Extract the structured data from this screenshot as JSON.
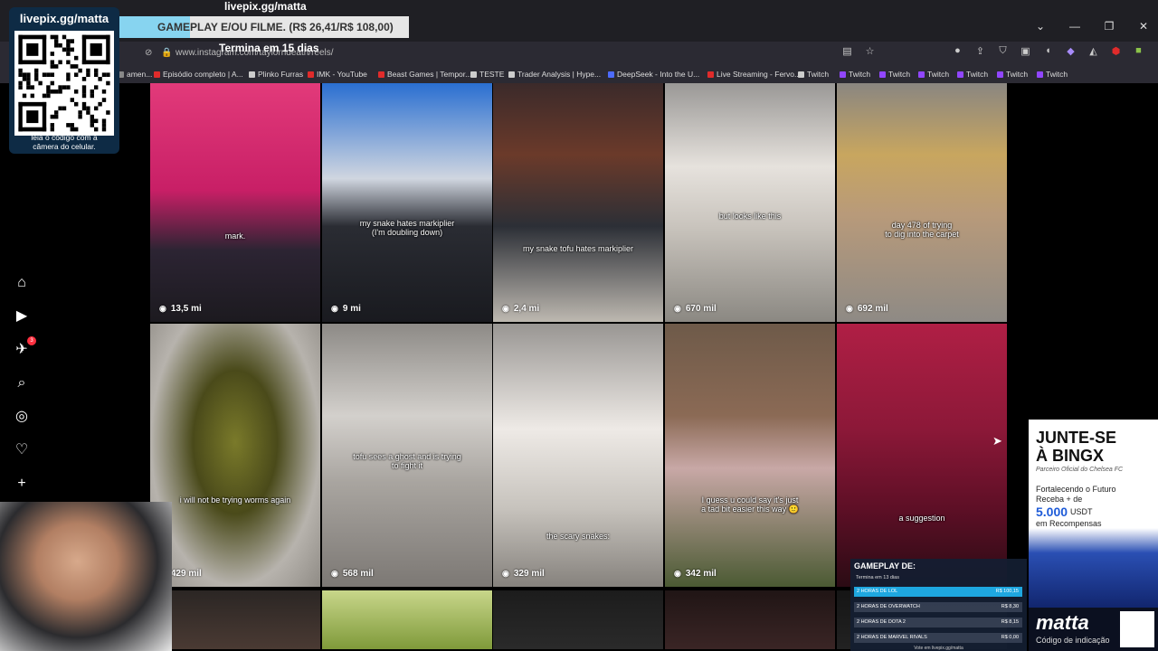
{
  "overlay": {
    "top_title": "livepix.gg/matta",
    "qr_title": "livepix.gg/matta",
    "qr_caption_1": "leia o código com a",
    "qr_caption_2": "câmera do celular.",
    "goal_label": "GAMEPLAY E/OU FILME. (R$ 26,41/R$ 108,00)",
    "goal_progress": 0.2445,
    "goal_sub": "Termina em 15 dias"
  },
  "browser": {
    "url": "www.instagram.com/taylorndeath/reels/",
    "bookmarks": [
      {
        "label": "amen...",
        "color": "#888888"
      },
      {
        "label": "Episódio completo | A...",
        "color": "#e02b2b"
      },
      {
        "label": "Plinko Furras",
        "color": "#cccccc"
      },
      {
        "label": "IMK - YouTube",
        "color": "#e02b2b"
      },
      {
        "label": "Beast Games | Tempor...",
        "color": "#e02b2b"
      },
      {
        "label": "TESTE",
        "color": "#cccccc"
      },
      {
        "label": "Trader Analysis | Hype...",
        "color": "#cccccc"
      },
      {
        "label": "DeepSeek - Into the U...",
        "color": "#4d6bfe"
      },
      {
        "label": "Live Streaming - Fervo...",
        "color": "#e02b2b"
      },
      {
        "label": "Twitch",
        "color": "#cccccc"
      },
      {
        "label": "Twitch",
        "color": "#9146ff"
      },
      {
        "label": "Twitch",
        "color": "#9146ff"
      },
      {
        "label": "Twitch",
        "color": "#9146ff"
      },
      {
        "label": "Twitch",
        "color": "#9146ff"
      },
      {
        "label": "Twitch",
        "color": "#9146ff"
      },
      {
        "label": "Twitch",
        "color": "#9146ff"
      }
    ]
  },
  "nav": {
    "badge_count": "3",
    "items": [
      "home-icon",
      "reels-icon",
      "messages-icon",
      "search-icon",
      "explore-icon",
      "notifications-icon",
      "create-icon",
      "insights-icon",
      "profile-avatar"
    ]
  },
  "reels": [
    {
      "views": "13,5 mi",
      "caption": "mark.",
      "bg": "linear-gradient(180deg,#e23a7a 0%,#c81f66 45%,#2c2433 70%,#1c1a1f 100%)"
    },
    {
      "views": "9 mi",
      "caption": "my snake hates markiplier\n(I'm doubling down)",
      "bg": "linear-gradient(180deg,#2a6fd1 0%,#d0d6e0 40%,#2a2c33 60%,#191a1f 100%)"
    },
    {
      "views": "2,4 mi",
      "caption": "my snake tofu hates markiplier",
      "bg": "linear-gradient(180deg,#3b2a2a 0%,#6b3a2a 30%,#2c2f36 60%,#bdb8b0 100%)"
    },
    {
      "views": "670 mil",
      "caption": "but looks like this",
      "bg": "linear-gradient(180deg,#9a9896 0%,#e6e2dd 35%,#c9c4bd 60%,#8b8882 100%)"
    },
    {
      "views": "692 mil",
      "caption": "day 478 of trying\nto dig into the carpet",
      "bg": "linear-gradient(180deg,#8a8681 0%,#c8a65f 30%,#b89a7a 55%,#8e8a85 100%)"
    },
    {
      "views": "429 mil",
      "caption": "i will not be trying worms again",
      "bg": "radial-gradient(ellipse at 50% 45%,#7a7a2a 0%,#4a4a1a 35%,#b7b3ad 70%,#8f8b85 100%)"
    },
    {
      "views": "568 mil",
      "caption": "tofu sees a ghost and is trying\nto fight it",
      "bg": "linear-gradient(180deg,#8d8a86 0%,#d3d0cc 35%,#a9a5a0 60%,#7c7874 100%)"
    },
    {
      "views": "329 mil",
      "caption": "the scary snakes:",
      "bg": "linear-gradient(180deg,#999693 0%,#eeeae6 40%,#c7c3bd 70%,#86827d 100%)"
    },
    {
      "views": "342 mil",
      "caption": "I guess u could say it's just\na tad bit easier this way 🙂",
      "bg": "linear-gradient(180deg,#6e5a49 0%,#8b6a55 35%,#c8a8a6 55%,#4b5a33 100%)"
    },
    {
      "views": "",
      "caption": "a suggestion",
      "bg": "linear-gradient(180deg,#b01f45 0%,#8c1838 40%,#5e0f26 70%,#2a0b14 100%)"
    },
    {
      "views": "",
      "caption": "",
      "bg": "linear-gradient(180deg,#2b2624 0%,#4a3a33 100%)"
    },
    {
      "views": "",
      "caption": "",
      "bg": "linear-gradient(180deg,#c8d68a 0%,#7f9a3a 100%)"
    },
    {
      "views": "",
      "caption": "",
      "bg": "linear-gradient(180deg,#1c1c1c 0%,#2a2a2a 100%)"
    },
    {
      "views": "",
      "caption": "",
      "bg": "linear-gradient(180deg,#201515 0%,#3a2525 100%)"
    },
    {
      "views": "",
      "caption": "",
      "bg": "linear-gradient(180deg,#151515 0%,#222 100%)"
    }
  ],
  "ad": {
    "title_1": "JUNTE-SE",
    "title_2": "À BINGX",
    "subtitle": "Parceiro Oficial do Chelsea FC",
    "body_1": "Fortalecendo o Futuro",
    "body_2": "Receba + de",
    "amount": "5.000",
    "currency": "USDT",
    "rewards": "em Recompensas",
    "brand": "matta",
    "brand_caption": "Código de indicação"
  },
  "gameplay": {
    "title": "GAMEPLAY DE:",
    "subtitle": "Termina em 13 dias",
    "rows": [
      {
        "label": "2 HORAS DE LOL",
        "price": "R$ 100,15",
        "active": true
      },
      {
        "label": "2 HORAS DE OVERWATCH",
        "price": "R$ 8,30",
        "active": false
      },
      {
        "label": "2 HORAS DE DOTA 2",
        "price": "R$ 8,15",
        "active": false
      },
      {
        "label": "2 HORAS DE MARVEL RIVALS",
        "price": "R$ 0,00",
        "active": false
      }
    ],
    "footer": "Vote em livepix.gg/matta"
  }
}
